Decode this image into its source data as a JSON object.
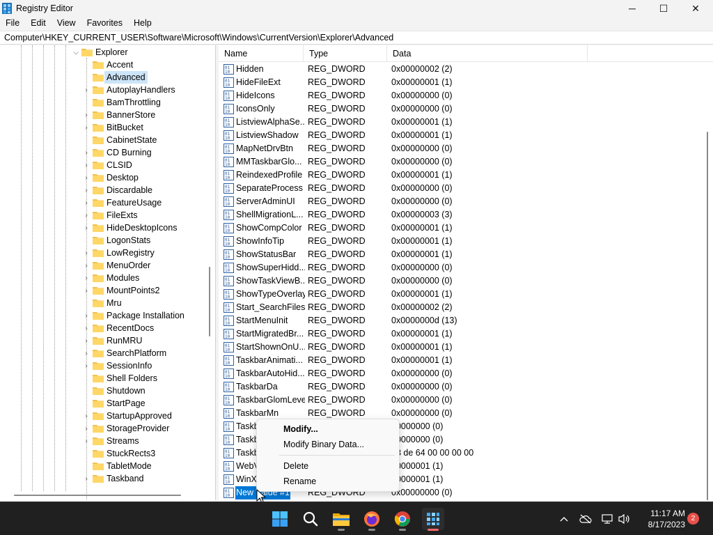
{
  "window": {
    "title": "Registry Editor",
    "controls": {
      "minimize": "─",
      "maximize": "☐",
      "close": "✕"
    }
  },
  "menu": [
    "File",
    "Edit",
    "View",
    "Favorites",
    "Help"
  ],
  "address": "Computer\\HKEY_CURRENT_USER\\Software\\Microsoft\\Windows\\CurrentVersion\\Explorer\\Advanced",
  "tree": {
    "parent": "Explorer",
    "items": [
      {
        "label": "Accent",
        "expandable": false
      },
      {
        "label": "Advanced",
        "expandable": false,
        "selected": true
      },
      {
        "label": "AutoplayHandlers",
        "expandable": true
      },
      {
        "label": "BamThrottling",
        "expandable": false
      },
      {
        "label": "BannerStore",
        "expandable": true
      },
      {
        "label": "BitBucket",
        "expandable": true
      },
      {
        "label": "CabinetState",
        "expandable": false
      },
      {
        "label": "CD Burning",
        "expandable": true
      },
      {
        "label": "CLSID",
        "expandable": true
      },
      {
        "label": "Desktop",
        "expandable": true
      },
      {
        "label": "Discardable",
        "expandable": true
      },
      {
        "label": "FeatureUsage",
        "expandable": true
      },
      {
        "label": "FileExts",
        "expandable": true
      },
      {
        "label": "HideDesktopIcons",
        "expandable": true
      },
      {
        "label": "LogonStats",
        "expandable": false
      },
      {
        "label": "LowRegistry",
        "expandable": true
      },
      {
        "label": "MenuOrder",
        "expandable": true
      },
      {
        "label": "Modules",
        "expandable": true
      },
      {
        "label": "MountPoints2",
        "expandable": true
      },
      {
        "label": "Mru",
        "expandable": false
      },
      {
        "label": "Package Installation",
        "expandable": true
      },
      {
        "label": "RecentDocs",
        "expandable": true
      },
      {
        "label": "RunMRU",
        "expandable": true
      },
      {
        "label": "SearchPlatform",
        "expandable": true
      },
      {
        "label": "SessionInfo",
        "expandable": true
      },
      {
        "label": "Shell Folders",
        "expandable": false
      },
      {
        "label": "Shutdown",
        "expandable": false
      },
      {
        "label": "StartPage",
        "expandable": false
      },
      {
        "label": "StartupApproved",
        "expandable": true
      },
      {
        "label": "StorageProvider",
        "expandable": true
      },
      {
        "label": "Streams",
        "expandable": true
      },
      {
        "label": "StuckRects3",
        "expandable": false
      },
      {
        "label": "TabletMode",
        "expandable": false
      },
      {
        "label": "Taskband",
        "expandable": true
      }
    ]
  },
  "columns": {
    "name": "Name",
    "type": "Type",
    "data": "Data"
  },
  "values": [
    {
      "name": "Hidden",
      "type": "REG_DWORD",
      "data": "0x00000002 (2)"
    },
    {
      "name": "HideFileExt",
      "type": "REG_DWORD",
      "data": "0x00000001 (1)"
    },
    {
      "name": "HideIcons",
      "type": "REG_DWORD",
      "data": "0x00000000 (0)"
    },
    {
      "name": "IconsOnly",
      "type": "REG_DWORD",
      "data": "0x00000000 (0)"
    },
    {
      "name": "ListviewAlphaSe...",
      "type": "REG_DWORD",
      "data": "0x00000001 (1)"
    },
    {
      "name": "ListviewShadow",
      "type": "REG_DWORD",
      "data": "0x00000001 (1)"
    },
    {
      "name": "MapNetDrvBtn",
      "type": "REG_DWORD",
      "data": "0x00000000 (0)"
    },
    {
      "name": "MMTaskbarGlo...",
      "type": "REG_DWORD",
      "data": "0x00000000 (0)"
    },
    {
      "name": "ReindexedProfile",
      "type": "REG_DWORD",
      "data": "0x00000001 (1)"
    },
    {
      "name": "SeparateProcess",
      "type": "REG_DWORD",
      "data": "0x00000000 (0)"
    },
    {
      "name": "ServerAdminUI",
      "type": "REG_DWORD",
      "data": "0x00000000 (0)"
    },
    {
      "name": "ShellMigrationL...",
      "type": "REG_DWORD",
      "data": "0x00000003 (3)"
    },
    {
      "name": "ShowCompColor",
      "type": "REG_DWORD",
      "data": "0x00000001 (1)"
    },
    {
      "name": "ShowInfoTip",
      "type": "REG_DWORD",
      "data": "0x00000001 (1)"
    },
    {
      "name": "ShowStatusBar",
      "type": "REG_DWORD",
      "data": "0x00000001 (1)"
    },
    {
      "name": "ShowSuperHidd...",
      "type": "REG_DWORD",
      "data": "0x00000000 (0)"
    },
    {
      "name": "ShowTaskViewB...",
      "type": "REG_DWORD",
      "data": "0x00000000 (0)"
    },
    {
      "name": "ShowTypeOverlay",
      "type": "REG_DWORD",
      "data": "0x00000001 (1)"
    },
    {
      "name": "Start_SearchFiles",
      "type": "REG_DWORD",
      "data": "0x00000002 (2)"
    },
    {
      "name": "StartMenuInit",
      "type": "REG_DWORD",
      "data": "0x0000000d (13)"
    },
    {
      "name": "StartMigratedBr...",
      "type": "REG_DWORD",
      "data": "0x00000001 (1)"
    },
    {
      "name": "StartShownOnU...",
      "type": "REG_DWORD",
      "data": "0x00000001 (1)"
    },
    {
      "name": "TaskbarAnimati...",
      "type": "REG_DWORD",
      "data": "0x00000001 (1)"
    },
    {
      "name": "TaskbarAutoHid...",
      "type": "REG_DWORD",
      "data": "0x00000000 (0)"
    },
    {
      "name": "TaskbarDa",
      "type": "REG_DWORD",
      "data": "0x00000000 (0)"
    },
    {
      "name": "TaskbarGlomLevel",
      "type": "REG_DWORD",
      "data": "0x00000000 (0)"
    },
    {
      "name": "TaskbarMn",
      "type": "REG_DWORD",
      "data": "0x00000000 (0)"
    },
    {
      "name": "Taskb",
      "type": "",
      "data": "00000000 (0)"
    },
    {
      "name": "Taskb",
      "type": "",
      "data": "00000000 (0)"
    },
    {
      "name": "Taskb",
      "type": "",
      "data": "63 de 64 00 00 00 00"
    },
    {
      "name": "WebV",
      "type": "",
      "data": "00000001 (1)"
    },
    {
      "name": "WinXI",
      "type": "",
      "data": "00000001 (1)"
    },
    {
      "name": "New Value #1",
      "type": "REG_DWORD",
      "data": "0x00000000 (0)",
      "selected": true
    }
  ],
  "context_menu": {
    "modify": "Modify...",
    "modify_binary": "Modify Binary Data...",
    "delete": "Delete",
    "rename": "Rename"
  },
  "taskbar": {
    "time": "11:17 AM",
    "date": "8/17/2023",
    "notifications": "2",
    "icons": [
      "windows-start-icon",
      "search-icon",
      "file-explorer-icon",
      "firefox-icon",
      "chrome-icon",
      "regedit-icon"
    ]
  }
}
